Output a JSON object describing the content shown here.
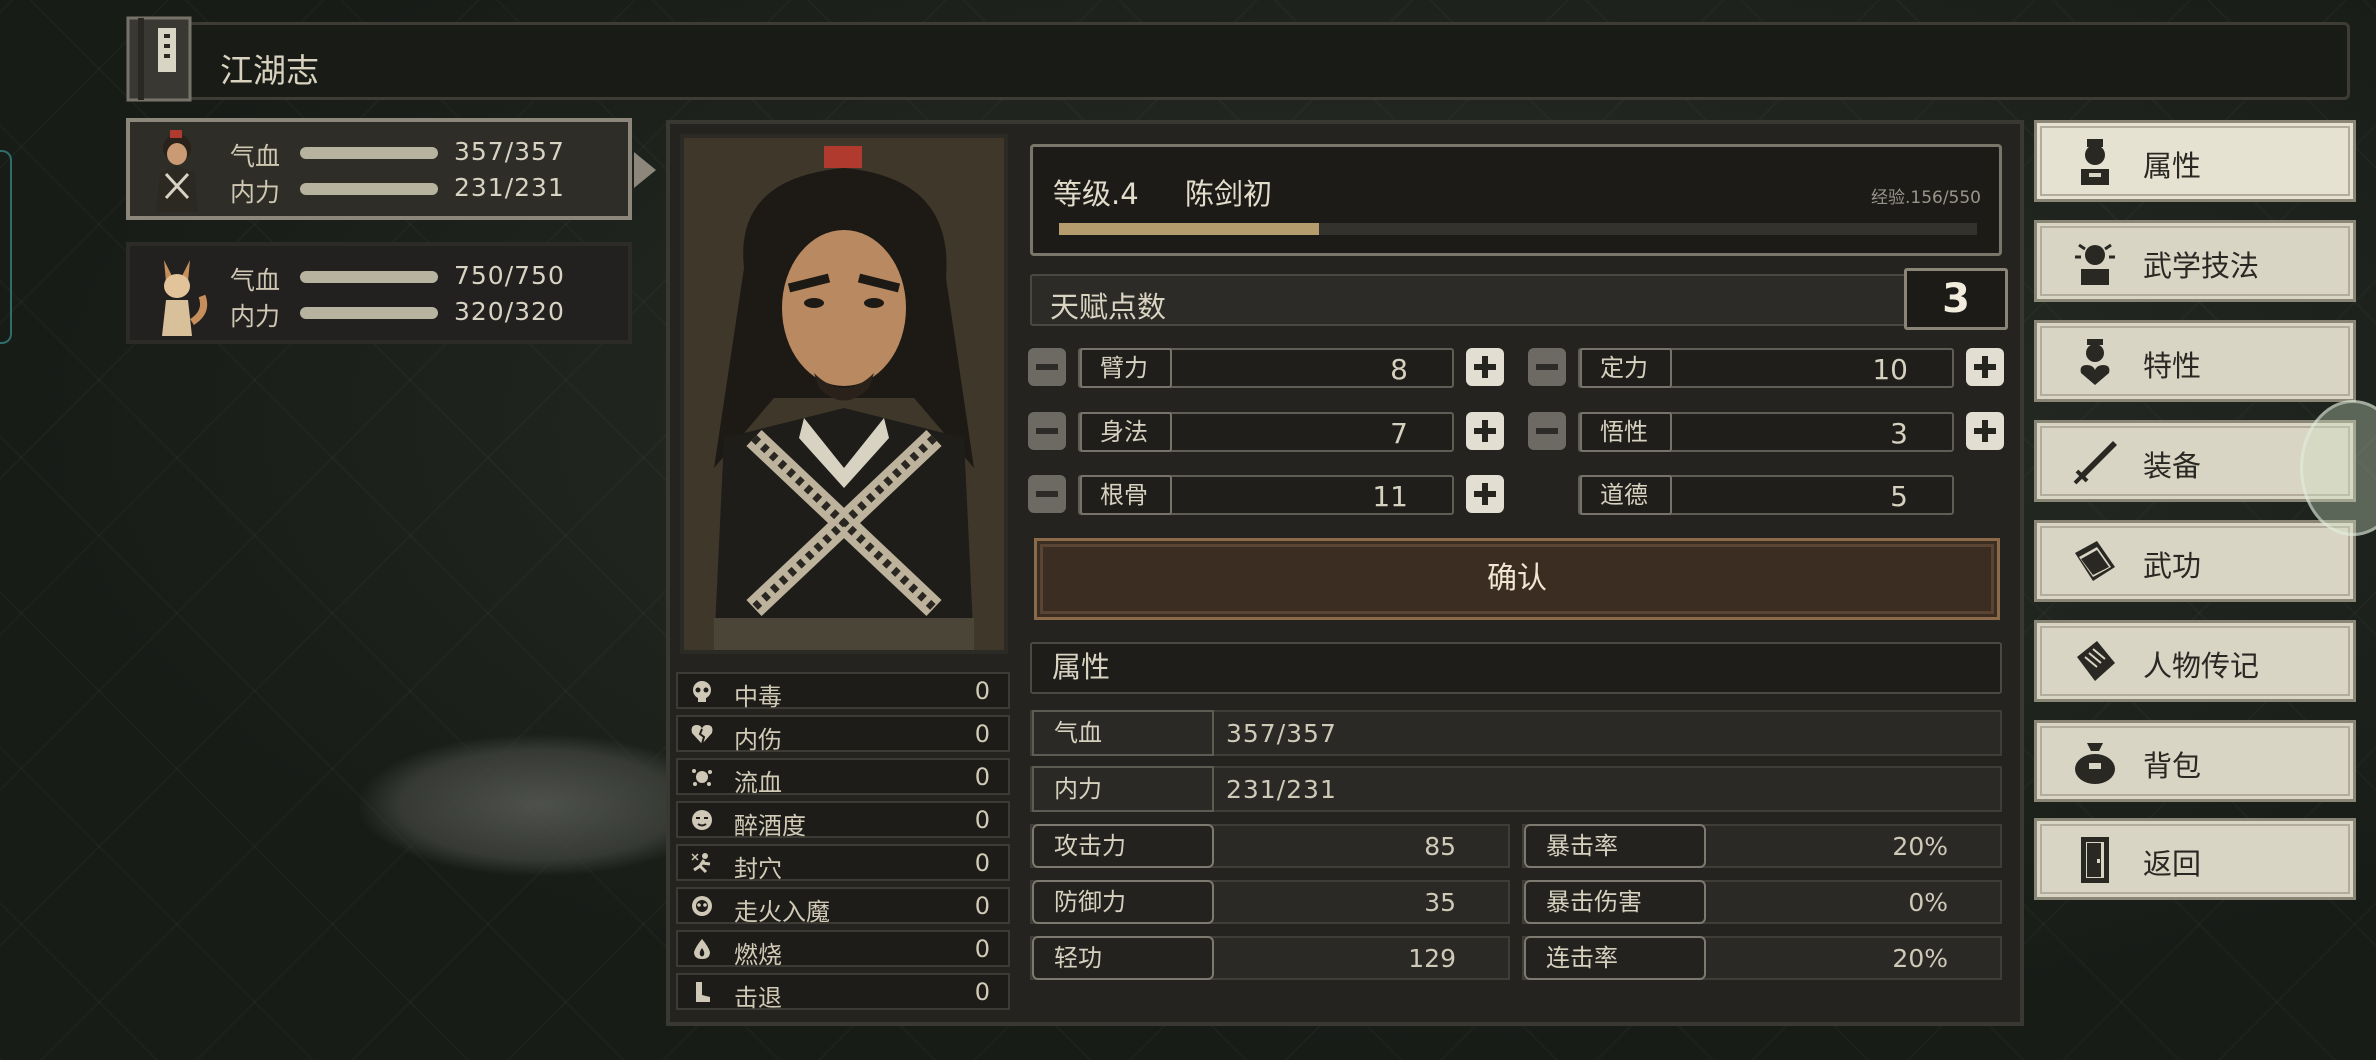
{
  "window": {
    "title": "江湖志"
  },
  "party": [
    {
      "hp_label": "气血",
      "hp": "357/357",
      "mp_label": "内力",
      "mp": "231/231",
      "selected": true
    },
    {
      "hp_label": "气血",
      "hp": "750/750",
      "mp_label": "内力",
      "mp": "320/320",
      "selected": false
    }
  ],
  "status_effects": [
    {
      "name": "中毒",
      "value": "0",
      "icon": "skull-icon"
    },
    {
      "name": "内伤",
      "value": "0",
      "icon": "broken-heart-icon"
    },
    {
      "name": "流血",
      "value": "0",
      "icon": "blood-splat-icon"
    },
    {
      "name": "醉酒度",
      "value": "0",
      "icon": "drunk-face-icon"
    },
    {
      "name": "封穴",
      "value": "0",
      "icon": "sealed-acupoint-icon"
    },
    {
      "name": "走火入魔",
      "value": "0",
      "icon": "demon-skull-icon"
    },
    {
      "name": "燃烧",
      "value": "0",
      "icon": "flame-icon"
    },
    {
      "name": "击退",
      "value": "0",
      "icon": "boot-icon"
    }
  ],
  "character": {
    "level_text": "等级.4",
    "name": "陈剑初",
    "exp_text": "经验.156/550",
    "exp_fraction": 0.2836
  },
  "talent": {
    "label": "天赋点数",
    "points": "3"
  },
  "attributes": [
    {
      "name": "臂力",
      "value": "8",
      "minus": true,
      "plus": true
    },
    {
      "name": "定力",
      "value": "10",
      "minus": true,
      "plus": true
    },
    {
      "name": "身法",
      "value": "7",
      "minus": true,
      "plus": true
    },
    {
      "name": "悟性",
      "value": "3",
      "minus": true,
      "plus": true
    },
    {
      "name": "根骨",
      "value": "11",
      "minus": true,
      "plus": true
    },
    {
      "name": "道德",
      "value": "5",
      "minus": false,
      "plus": false
    }
  ],
  "confirm_label": "确认",
  "properties": {
    "header": "属性",
    "hp": {
      "label": "气血",
      "value": "357/357"
    },
    "mp": {
      "label": "内力",
      "value": "231/231"
    },
    "stats": [
      {
        "label": "攻击力",
        "value": "85"
      },
      {
        "label": "暴击率",
        "value": "20%"
      },
      {
        "label": "防御力",
        "value": "35"
      },
      {
        "label": "暴击伤害",
        "value": "0%"
      },
      {
        "label": "轻功",
        "value": "129"
      },
      {
        "label": "连击率",
        "value": "20%"
      }
    ]
  },
  "menu": [
    {
      "label": "属性",
      "icon": "character-icon",
      "active": true
    },
    {
      "label": "武学技法",
      "icon": "martial-technique-icon",
      "active": false
    },
    {
      "label": "特性",
      "icon": "trait-icon",
      "active": false
    },
    {
      "label": "装备",
      "icon": "sword-icon",
      "active": false
    },
    {
      "label": "武功",
      "icon": "martial-book-icon",
      "active": false
    },
    {
      "label": "人物传记",
      "icon": "scroll-icon",
      "active": false
    },
    {
      "label": "背包",
      "icon": "bag-icon",
      "active": false
    },
    {
      "label": "返回",
      "icon": "door-icon",
      "active": false
    }
  ],
  "colors": {
    "exp_fill": "#b59d6d",
    "panel_bg": "#24231f",
    "menu_bg": "#d9d5c4",
    "confirm_bg": "#3c2d22"
  }
}
